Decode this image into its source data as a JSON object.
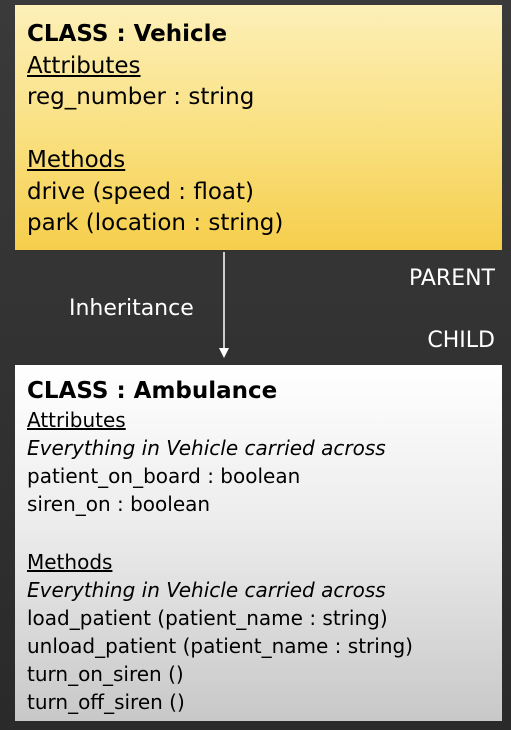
{
  "parent": {
    "title": "CLASS : Vehicle",
    "attributes_heading": "Attributes",
    "attributes": [
      "reg_number : string"
    ],
    "methods_heading": "Methods",
    "methods": [
      "drive (speed : float)",
      "park (location : string)"
    ]
  },
  "child": {
    "title": "CLASS : Ambulance",
    "attributes_heading": "Attributes",
    "attributes_note": "Everything in Vehicle carried across",
    "attributes": [
      "patient_on_board : boolean",
      "siren_on : boolean"
    ],
    "methods_heading": "Methods",
    "methods_note": "Everything in Vehicle carried across",
    "methods": [
      "load_patient (patient_name : string)",
      "unload_patient (patient_name : string)",
      "turn_on_siren ()",
      "turn_off_siren ()"
    ]
  },
  "relationship": {
    "label": "Inheritance",
    "parent_label": "PARENT",
    "child_label": "CHILD",
    "arrow_color": "#ffffff"
  },
  "colors": {
    "background": "#333333",
    "parent_fill": "#f9df7e",
    "child_fill": "#e6e6e6",
    "label_text": "#ffffff"
  }
}
